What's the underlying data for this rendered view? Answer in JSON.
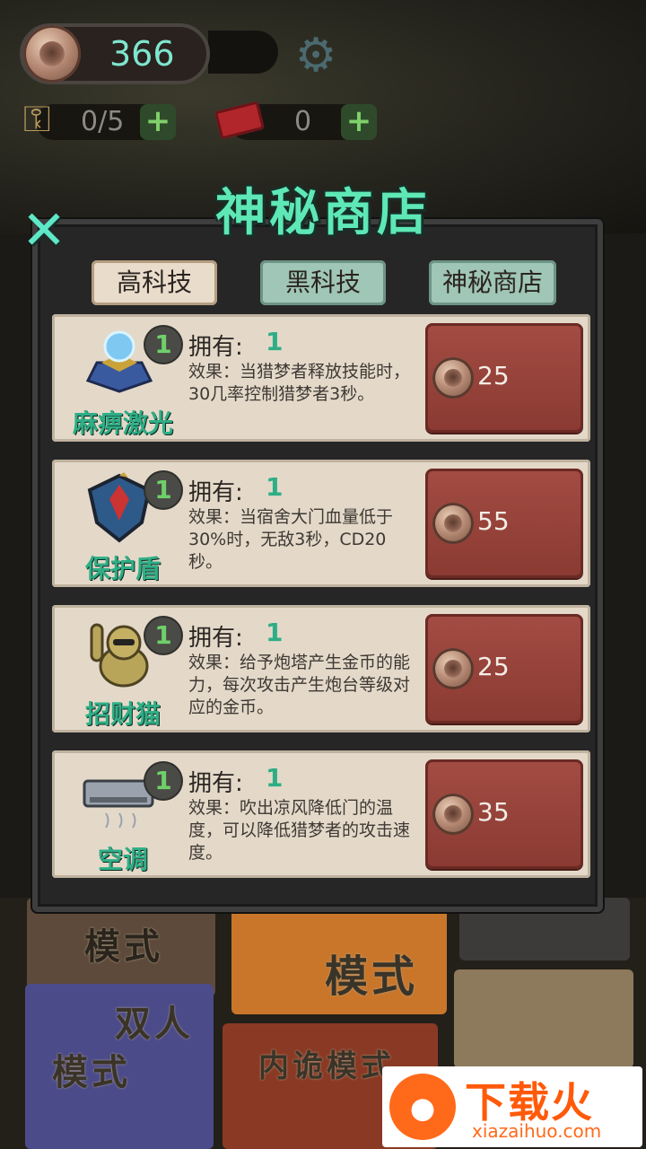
{
  "hud": {
    "coin_count": "366",
    "keys": "0/5",
    "tickets": "0"
  },
  "dialog": {
    "title": "神秘商店",
    "tabs": [
      {
        "label": "高科技",
        "active": true
      },
      {
        "label": "黑科技",
        "active": false
      },
      {
        "label": "神秘商店",
        "active": false
      }
    ],
    "own_label": "拥有:",
    "items": [
      {
        "name": "麻痹激光",
        "icon": "laser-trap-icon",
        "badge": "1",
        "owned": "1",
        "desc": "效果：当猎梦者释放技能时，30几率控制猎梦者3秒。",
        "price": "25"
      },
      {
        "name": "保护盾",
        "icon": "shield-icon",
        "badge": "1",
        "owned": "1",
        "desc": "效果：当宿舍大门血量低于30%时，无敌3秒，CD20秒。",
        "price": "55"
      },
      {
        "name": "招财猫",
        "icon": "lucky-cat-icon",
        "badge": "1",
        "owned": "1",
        "desc": "效果：给予炮塔产生金币的能力，每次攻击产生炮台等级对应的金币。",
        "price": "25"
      },
      {
        "name": "空调",
        "icon": "air-conditioner-icon",
        "badge": "1",
        "owned": "1",
        "desc": "效果：吹出凉风降低门的温度，可以降低猎梦者的攻击速度。",
        "price": "35"
      }
    ]
  },
  "background": {
    "modes": [
      "模式",
      "模式",
      "双人",
      "模式",
      "内诡模式"
    ]
  },
  "watermark": {
    "main": "下载火",
    "sub": "xiazaihuo.com"
  },
  "colors": {
    "accent_green": "#5ee8b6",
    "buy_button": "#9a443b",
    "card": "#e4d9c9"
  }
}
